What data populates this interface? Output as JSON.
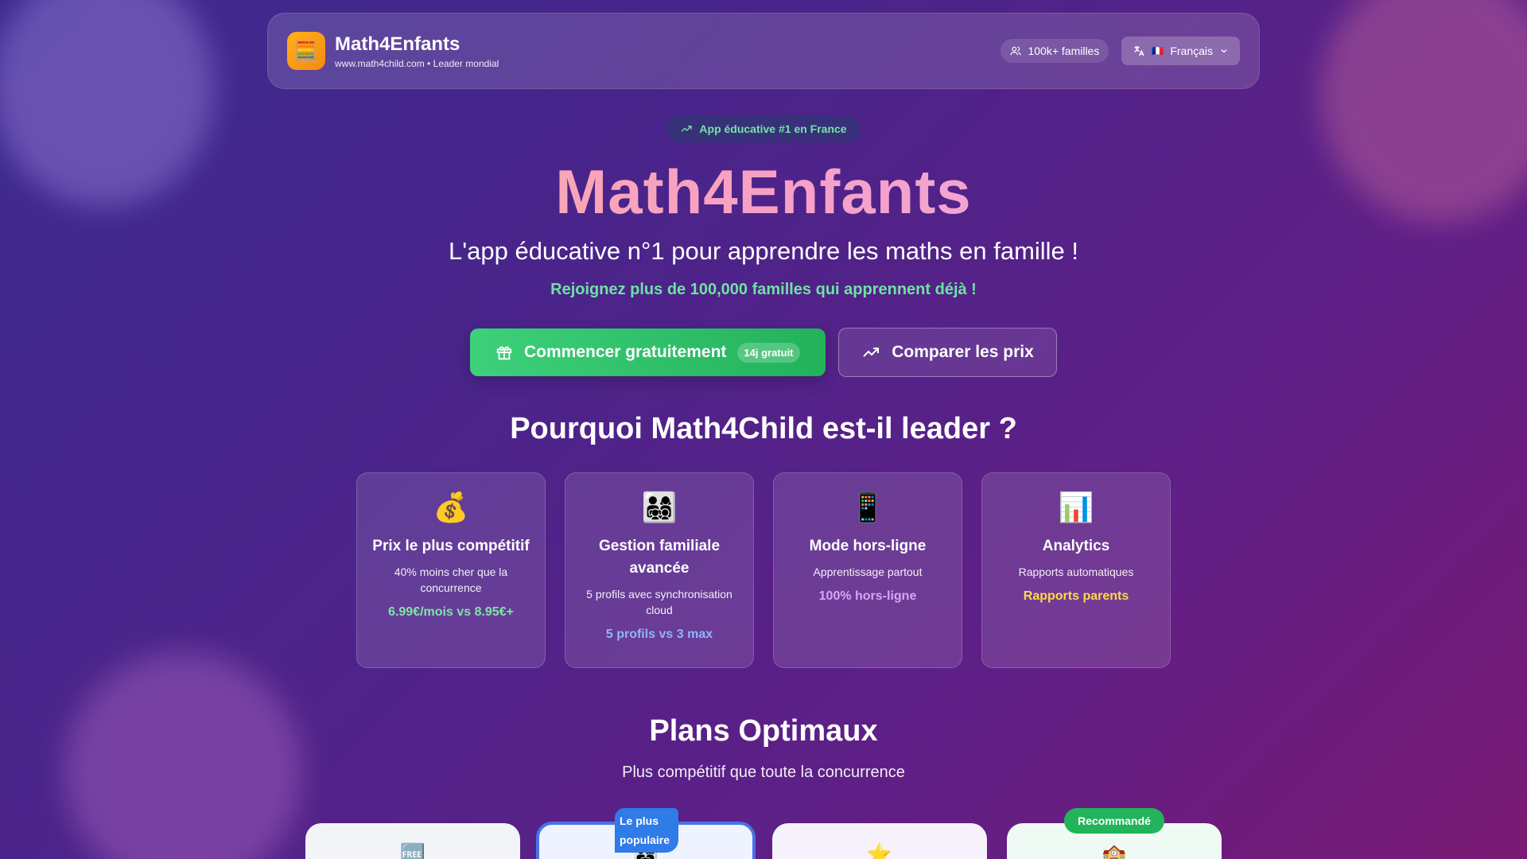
{
  "header": {
    "brand_name": "Math4Enfants",
    "brand_sub": "www.math4child.com • Leader mondial",
    "families_label": "100k+ familles",
    "language_label": "Français",
    "language_flag": "🇫🇷",
    "logo_icon": "🧮"
  },
  "hero": {
    "badge": "App éducative #1 en France",
    "title": "Math4Enfants",
    "subtitle": "L'app éducative n°1 pour apprendre les maths en famille !",
    "join": "Rejoignez plus de 100,000 familles qui apprennent déjà !",
    "cta_start": "Commencer gratuitement",
    "cta_start_tag": "14j gratuit",
    "cta_compare": "Comparer les prix"
  },
  "why": {
    "title": "Pourquoi Math4Child est-il leader ?",
    "features": [
      {
        "icon": "💰",
        "title": "Prix le plus compétitif",
        "desc": "40% moins cher que la concurrence",
        "stat": "6.99€/mois vs 8.95€+",
        "stat_color": "#7ee6a6"
      },
      {
        "icon": "👨‍👩‍👧‍👦",
        "title": "Gestion familiale avancée",
        "desc": "5 profils avec synchronisation cloud",
        "stat": "5 profils vs 3 max",
        "stat_color": "#8fb4ff"
      },
      {
        "icon": "📱",
        "title": "Mode hors-ligne",
        "desc": "Apprentissage partout",
        "stat": "100% hors-ligne",
        "stat_color": "#d7a7f5"
      },
      {
        "icon": "📊",
        "title": "Analytics",
        "desc": "Rapports automatiques",
        "stat": "Rapports parents",
        "stat_color": "#ffd84a"
      }
    ]
  },
  "plans": {
    "title": "Plans Optimaux",
    "subtitle": "Plus compétitif que toute la concurrence",
    "popular_label": "Le plus populaire",
    "recommended_label": "Recommandé",
    "icons": [
      "🆓",
      "👨‍👩‍👧",
      "⭐",
      "🏫"
    ]
  }
}
